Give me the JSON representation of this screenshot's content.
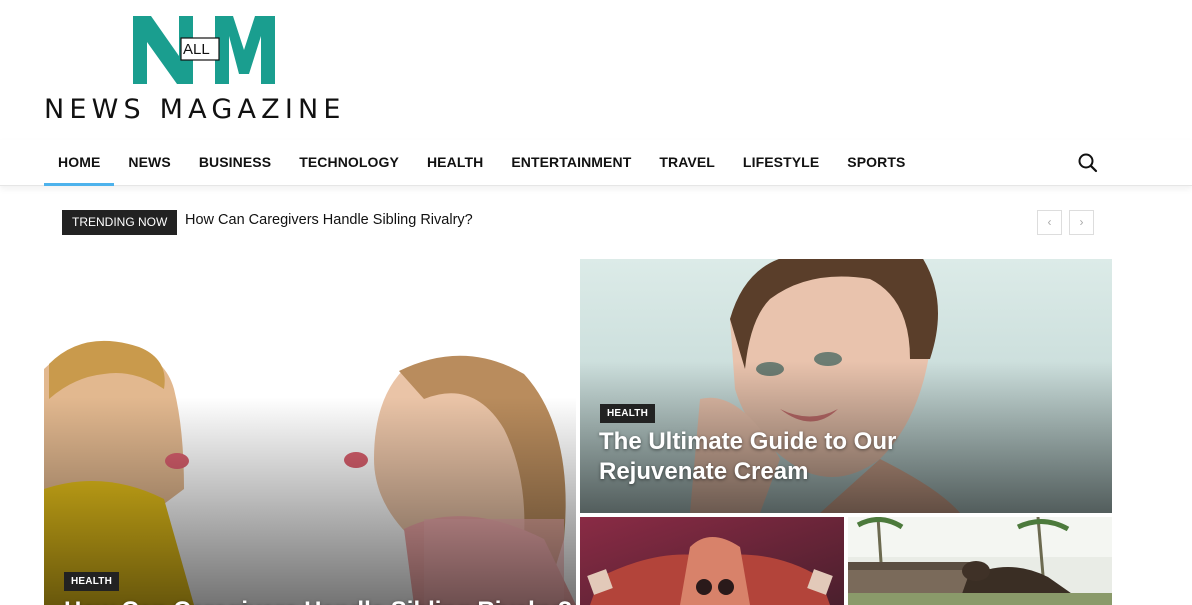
{
  "brand": {
    "logo_mark_text": "N M",
    "logo_all": "ALL",
    "tagline": "NEWS MAGAZINE",
    "color": "#1a9e8f"
  },
  "nav": {
    "items": [
      {
        "label": "HOME",
        "active": true
      },
      {
        "label": "NEWS"
      },
      {
        "label": "BUSINESS"
      },
      {
        "label": "TECHNOLOGY"
      },
      {
        "label": "HEALTH"
      },
      {
        "label": "ENTERTAINMENT"
      },
      {
        "label": "TRAVEL"
      },
      {
        "label": "LIFESTYLE"
      },
      {
        "label": "SPORTS"
      }
    ],
    "active_color": "#4db2ec",
    "search_icon": "search-icon"
  },
  "trending": {
    "badge": "TRENDING NOW",
    "headline": "How Can Caregivers Handle Sibling Rivalry?",
    "prev_icon": "‹",
    "next_icon": "›"
  },
  "featured": {
    "main": {
      "category": "HEALTH",
      "title": "How Can Caregivers Handle Sibling Rivalry?"
    },
    "right": {
      "category": "HEALTH",
      "title": "The Ultimate Guide to Our Rejuvenate Cream"
    }
  }
}
